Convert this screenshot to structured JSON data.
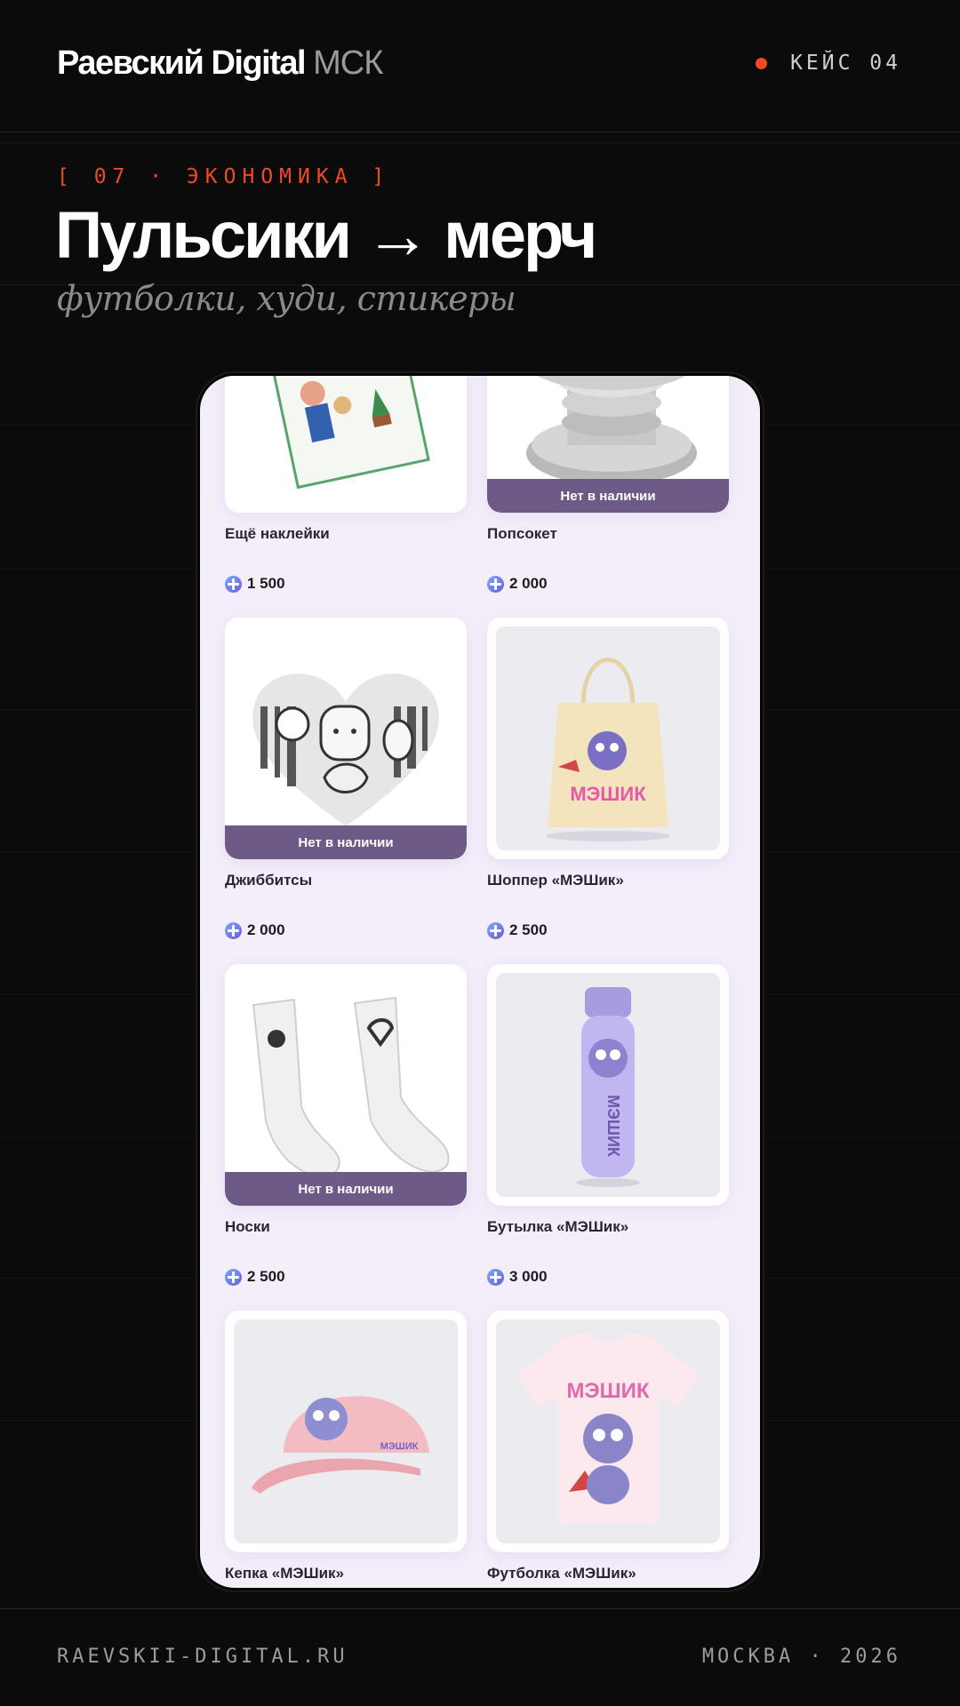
{
  "header": {
    "brand": "Раевский Digital",
    "brand_suffix": "МСК",
    "case_label": "КЕЙС 04",
    "accent_color": "#f04a23"
  },
  "section": {
    "tag": "[ 07 · ЭКОНОМИКА ]",
    "title": "Пульсики → мерч",
    "subtitle": "футболки, худи, стикеры"
  },
  "shop": {
    "currency_icon": "pulse-coin-icon",
    "out_of_stock_label": "Нет в наличии",
    "items": [
      {
        "name": "Ещё наклейки",
        "price": "1 500",
        "out_of_stock": false,
        "image": "stickers"
      },
      {
        "name": "Попсокет",
        "price": "2 000",
        "out_of_stock": true,
        "image": "popsocket"
      },
      {
        "name": "Джиббитсы",
        "price": "2 000",
        "out_of_stock": true,
        "image": "jibbitz"
      },
      {
        "name": "Шоппер «МЭШик»",
        "price": "2 500",
        "out_of_stock": false,
        "image": "tote-bag"
      },
      {
        "name": "Носки",
        "price": "2 500",
        "out_of_stock": true,
        "image": "socks"
      },
      {
        "name": "Бутылка «МЭШик»",
        "price": "3 000",
        "out_of_stock": false,
        "image": "bottle"
      },
      {
        "name": "Кепка «МЭШик»",
        "price": "",
        "out_of_stock": false,
        "image": "cap"
      },
      {
        "name": "Футболка «МЭШик»",
        "price": "",
        "out_of_stock": false,
        "image": "t-shirt"
      }
    ],
    "product_print": "МЭШИК",
    "badge_color": "#6e5a86"
  },
  "footer": {
    "site": "RAEVSKII-DIGITAL.RU",
    "location": "МОСКВА · 2026"
  }
}
